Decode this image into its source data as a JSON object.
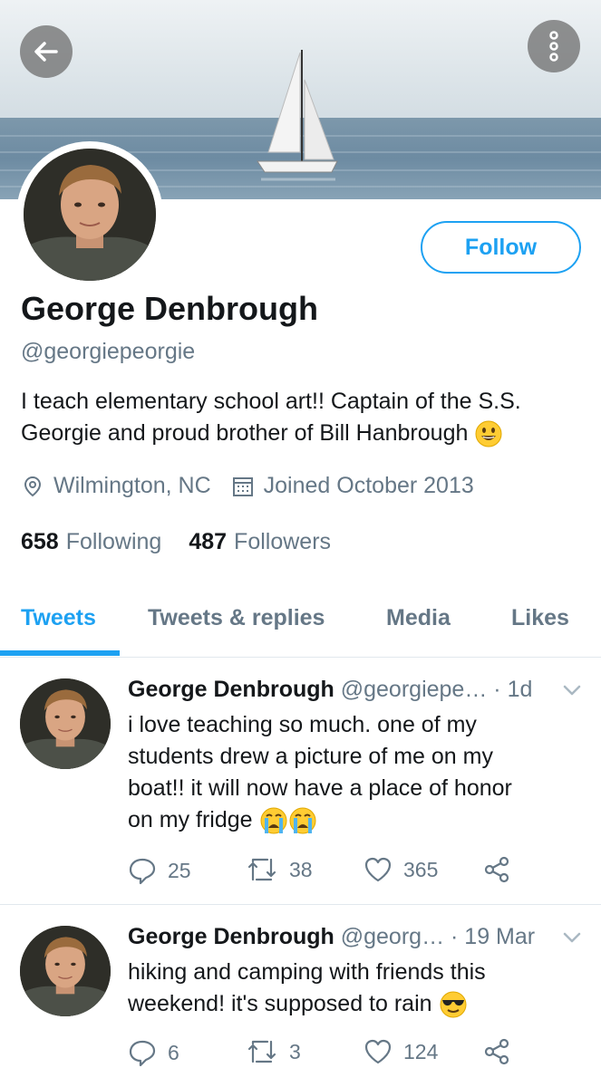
{
  "header": {
    "back_icon": "arrow-left-icon",
    "more_icon": "more-vertical-icon"
  },
  "profile": {
    "name": "George Denbrough",
    "handle": "@georgiepeorgie",
    "follow_label": "Follow",
    "bio_line1": "I teach elementary school art!! Captain of the S.S.",
    "bio_line2": "Georgie and proud brother of Bill Hanbrough",
    "location": "Wilmington, NC",
    "joined": "Joined October 2013",
    "following_count": "658",
    "following_label": "Following",
    "followers_count": "487",
    "followers_label": "Followers"
  },
  "tabs": [
    {
      "label": "Tweets",
      "active": true
    },
    {
      "label": "Tweets & replies",
      "active": false
    },
    {
      "label": "Media",
      "active": false
    },
    {
      "label": "Likes",
      "active": false
    }
  ],
  "tweets": [
    {
      "name": "George Denbrough",
      "handle": "@georgiepe…",
      "time": "· 1d",
      "lines": [
        "i love teaching so much. one of my",
        "students drew a picture of me on my",
        "boat!! it will now have a place of honor",
        "on my fridge"
      ],
      "replies": "25",
      "retweets": "38",
      "likes": "365"
    },
    {
      "name": "George Denbrough",
      "handle": "@georg…",
      "time": "· 19 Mar",
      "lines": [
        "hiking and camping with friends this",
        "weekend! it's supposed to rain"
      ],
      "replies": "6",
      "retweets": "3",
      "likes": "124"
    }
  ],
  "colors": {
    "accent": "#1da1f2",
    "muted": "#657786",
    "text": "#14171a"
  }
}
